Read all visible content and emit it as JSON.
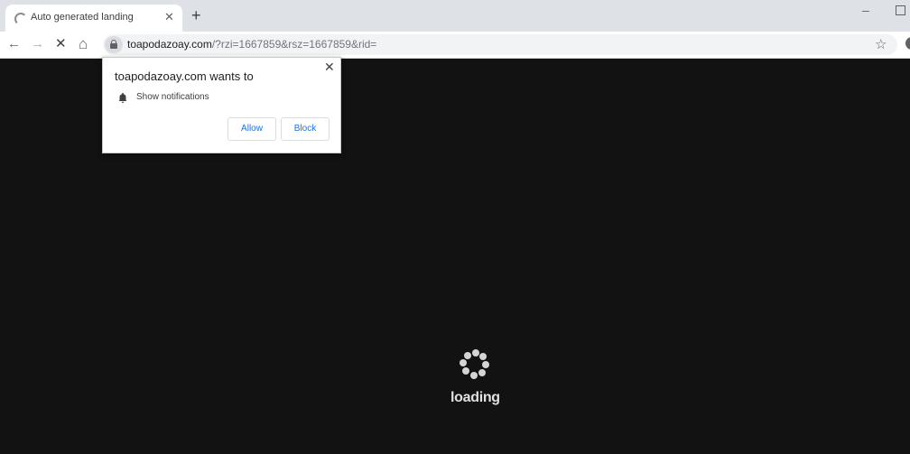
{
  "tab": {
    "title": "Auto generated landing",
    "close_icon": "close-icon",
    "loading_icon": "spinner-icon"
  },
  "new_tab_label": "+",
  "window": {
    "minimize": "–"
  },
  "toolbar": {
    "back": "←",
    "forward": "→",
    "stop": "✕",
    "home": "⌂",
    "url_host": "toapodazoay.com",
    "url_path": "/?rzi=1667859&rsz=1667859&rid=",
    "star": "☆"
  },
  "popup": {
    "title": "toapodazoay.com wants to",
    "permission": "Show notifications",
    "allow_label": "Allow",
    "block_label": "Block",
    "close": "✕"
  },
  "page": {
    "loading_text": "loading"
  }
}
